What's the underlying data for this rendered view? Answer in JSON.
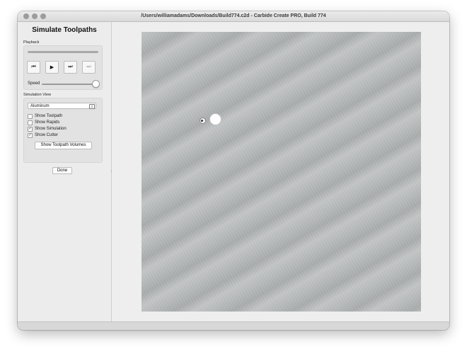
{
  "window": {
    "title": "/Users/williamadams/Downloads/Build774.c2d - Carbide Create PRO, Build 774"
  },
  "sidebar": {
    "title": "Simulate Toolpaths",
    "playback": {
      "label": "Playback",
      "progress": 0,
      "buttons": {
        "rewind_icon": "skip-to-start-icon",
        "rewind_glyph": "⏮",
        "play_icon": "play-icon",
        "play_glyph": "▶",
        "step_icon": "step-forward-icon",
        "step_glyph": "⏭",
        "end_icon": "skip-to-end-icon",
        "end_glyph": "⏭"
      },
      "speed_label": "Speed",
      "speed_value": 1.0
    },
    "simulation_view": {
      "label": "Simulation View",
      "material_selected": "Aluminum",
      "checkboxes": [
        {
          "label": "Show Toolpath",
          "checked": false
        },
        {
          "label": "Show Rapids",
          "checked": false
        },
        {
          "label": "Show Simulation",
          "checked": true
        },
        {
          "label": "Show Cutter",
          "checked": true
        }
      ],
      "volumes_button": "Show Toolpath Volumes"
    },
    "done_button": "Done"
  },
  "colors": {
    "stock": "#b4b7b8",
    "sidebar_bg": "#ececec",
    "canvas_bg": "#eeeeee"
  }
}
